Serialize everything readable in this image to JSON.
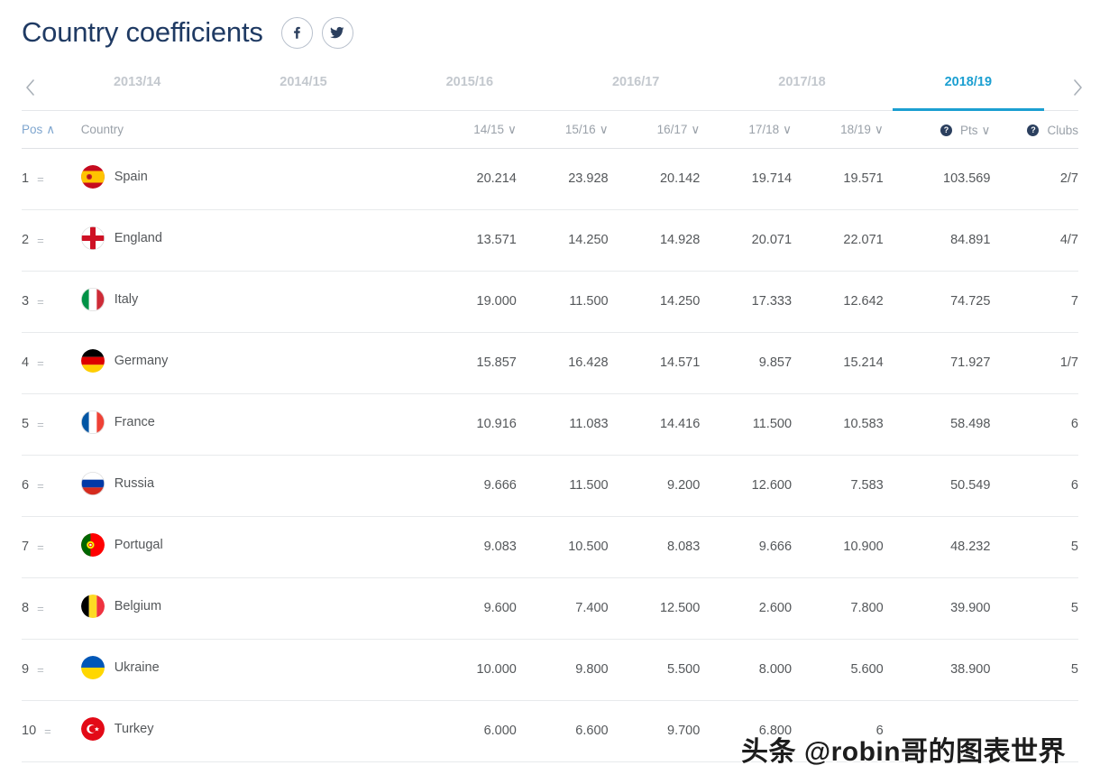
{
  "header": {
    "title": "Country coefficients",
    "social": [
      {
        "name": "facebook-share-button",
        "glyph": "f"
      },
      {
        "name": "twitter-share-button",
        "glyph": "t"
      }
    ]
  },
  "season_tabs": {
    "prev_arrow": "‹",
    "next_arrow": "›",
    "items": [
      {
        "label": "2013/14",
        "active": false
      },
      {
        "label": "2014/15",
        "active": false
      },
      {
        "label": "2015/16",
        "active": false
      },
      {
        "label": "2016/17",
        "active": false
      },
      {
        "label": "2017/18",
        "active": false
      },
      {
        "label": "2018/19",
        "active": true
      }
    ]
  },
  "table": {
    "columns": [
      {
        "key": "pos",
        "label": "Pos",
        "sorted": true,
        "chevron": "∧",
        "info": false
      },
      {
        "key": "ctry",
        "label": "Country",
        "sorted": false,
        "chevron": "",
        "info": false
      },
      {
        "key": "s1415",
        "label": "14/15",
        "sorted": false,
        "chevron": "∨",
        "info": false
      },
      {
        "key": "s1516",
        "label": "15/16",
        "sorted": false,
        "chevron": "∨",
        "info": false
      },
      {
        "key": "s1617",
        "label": "16/17",
        "sorted": false,
        "chevron": "∨",
        "info": false
      },
      {
        "key": "s1718",
        "label": "17/18",
        "sorted": false,
        "chevron": "∨",
        "info": false
      },
      {
        "key": "s1819",
        "label": "18/19",
        "sorted": false,
        "chevron": "∨",
        "info": false
      },
      {
        "key": "pts",
        "label": "Pts",
        "sorted": false,
        "chevron": "∨",
        "info": true
      },
      {
        "key": "clubs",
        "label": "Clubs",
        "sorted": false,
        "chevron": "",
        "info": true
      }
    ],
    "info_glyph": "?",
    "rows": [
      {
        "pos": "1",
        "move": "=",
        "country": "Spain",
        "flag": "spain",
        "s1415": "20.214",
        "s1516": "23.928",
        "s1617": "20.142",
        "s1718": "19.714",
        "s1819": "19.571",
        "pts": "103.569",
        "clubs": "2/7"
      },
      {
        "pos": "2",
        "move": "=",
        "country": "England",
        "flag": "england",
        "s1415": "13.571",
        "s1516": "14.250",
        "s1617": "14.928",
        "s1718": "20.071",
        "s1819": "22.071",
        "pts": "84.891",
        "clubs": "4/7"
      },
      {
        "pos": "3",
        "move": "=",
        "country": "Italy",
        "flag": "italy",
        "s1415": "19.000",
        "s1516": "11.500",
        "s1617": "14.250",
        "s1718": "17.333",
        "s1819": "12.642",
        "pts": "74.725",
        "clubs": "7"
      },
      {
        "pos": "4",
        "move": "=",
        "country": "Germany",
        "flag": "germany",
        "s1415": "15.857",
        "s1516": "16.428",
        "s1617": "14.571",
        "s1718": "9.857",
        "s1819": "15.214",
        "pts": "71.927",
        "clubs": "1/7"
      },
      {
        "pos": "5",
        "move": "=",
        "country": "France",
        "flag": "france",
        "s1415": "10.916",
        "s1516": "11.083",
        "s1617": "14.416",
        "s1718": "11.500",
        "s1819": "10.583",
        "pts": "58.498",
        "clubs": "6"
      },
      {
        "pos": "6",
        "move": "=",
        "country": "Russia",
        "flag": "russia",
        "s1415": "9.666",
        "s1516": "11.500",
        "s1617": "9.200",
        "s1718": "12.600",
        "s1819": "7.583",
        "pts": "50.549",
        "clubs": "6"
      },
      {
        "pos": "7",
        "move": "=",
        "country": "Portugal",
        "flag": "portugal",
        "s1415": "9.083",
        "s1516": "10.500",
        "s1617": "8.083",
        "s1718": "9.666",
        "s1819": "10.900",
        "pts": "48.232",
        "clubs": "5"
      },
      {
        "pos": "8",
        "move": "=",
        "country": "Belgium",
        "flag": "belgium",
        "s1415": "9.600",
        "s1516": "7.400",
        "s1617": "12.500",
        "s1718": "2.600",
        "s1819": "7.800",
        "pts": "39.900",
        "clubs": "5"
      },
      {
        "pos": "9",
        "move": "=",
        "country": "Ukraine",
        "flag": "ukraine",
        "s1415": "10.000",
        "s1516": "9.800",
        "s1617": "5.500",
        "s1718": "8.000",
        "s1819": "5.600",
        "pts": "38.900",
        "clubs": "5"
      },
      {
        "pos": "10",
        "move": "=",
        "country": "Turkey",
        "flag": "turkey",
        "s1415": "6.000",
        "s1516": "6.600",
        "s1617": "9.700",
        "s1718": "6.800",
        "s1819": "6",
        "pts": "",
        "clubs": ""
      }
    ]
  },
  "watermark": {
    "text": "头条 @robin哥的图表世界"
  },
  "colors": {
    "accent": "#1b9fd1",
    "title": "#1f3a63",
    "text": "#54575a",
    "muted": "#9aa1a9",
    "tab_inactive": "#c3c8ce",
    "sorted": "#7fa6cf",
    "info_badge": "#2b3f5e",
    "row_border": "#e8eaec"
  }
}
